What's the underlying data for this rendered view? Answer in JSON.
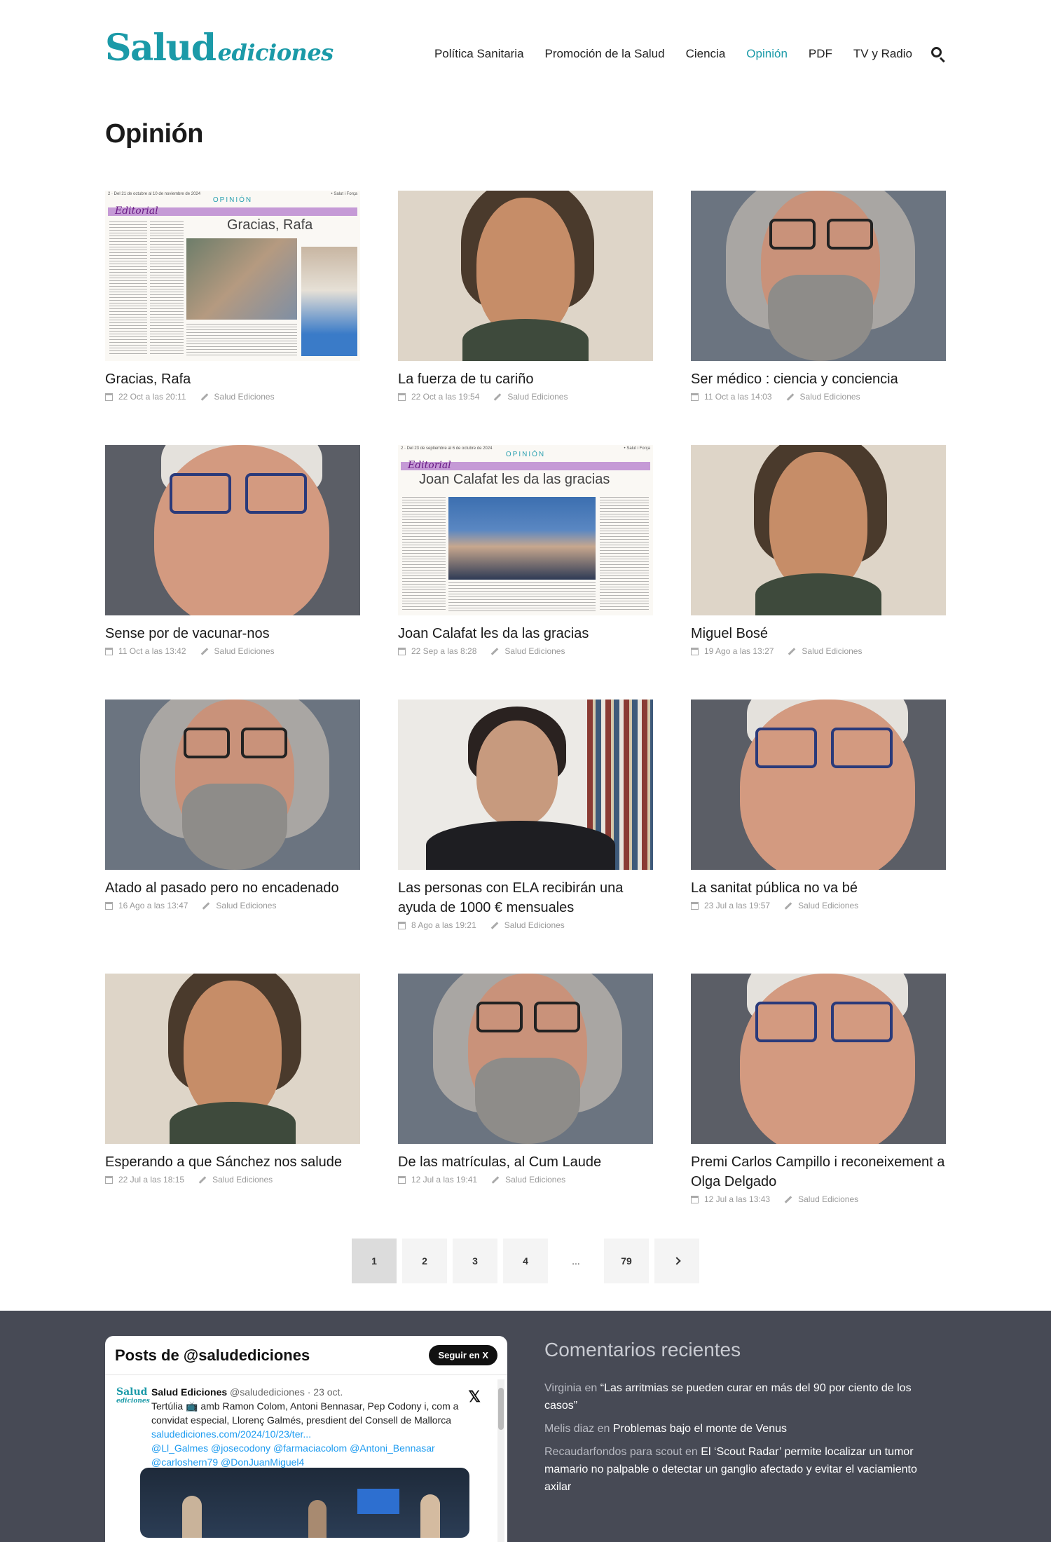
{
  "header": {
    "logo_main": "Salud",
    "logo_sub": "ediciones",
    "nav": [
      {
        "label": "Política Sanitaria",
        "active": false
      },
      {
        "label": "Promoción de la Salud",
        "active": false
      },
      {
        "label": "Ciencia",
        "active": false
      },
      {
        "label": "Opinión",
        "active": true
      },
      {
        "label": "PDF",
        "active": false
      },
      {
        "label": "TV y Radio",
        "active": false
      }
    ],
    "accent": "#1b9aa8"
  },
  "page_title": "Opinión",
  "articles": [
    {
      "title": "Gracias, Rafa",
      "date": "22 Oct a las 20:11",
      "author": "Salud Ediciones",
      "thumb": "newspaper-gracias-rafa"
    },
    {
      "title": "La fuerza de tu cariño",
      "date": "22 Oct a las 19:54",
      "author": "Salud Ediciones",
      "thumb": "portrait-long-hair-man"
    },
    {
      "title": "Ser médico : ciencia y conciencia",
      "date": "11 Oct a las 14:03",
      "author": "Salud Ediciones",
      "thumb": "portrait-grey-beard-man"
    },
    {
      "title": "Sense por de vacunar-nos",
      "date": "11 Oct a las 13:42",
      "author": "Salud Ediciones",
      "thumb": "portrait-smiling-man-glasses"
    },
    {
      "title": "Joan Calafat les da las gracias",
      "date": "22 Sep a las 8:28",
      "author": "Salud Ediciones",
      "thumb": "newspaper-joan-calafat"
    },
    {
      "title": "Miguel Bosé",
      "date": "19 Ago a las 13:27",
      "author": "Salud Ediciones",
      "thumb": "portrait-long-hair-man"
    },
    {
      "title": "Atado al pasado pero no encadenado",
      "date": "16 Ago a las 13:47",
      "author": "Salud Ediciones",
      "thumb": "portrait-grey-beard-man"
    },
    {
      "title": "Las personas con ELA recibirán una ayuda de 1000 € mensuales",
      "date": "8 Ago a las 19:21",
      "author": "Salud Ediciones",
      "thumb": "portrait-woman-bookshelf"
    },
    {
      "title": "La sanitat pública no va bé",
      "date": "23 Jul a las 19:57",
      "author": "Salud Ediciones",
      "thumb": "portrait-smiling-man-glasses"
    },
    {
      "title": "Esperando a que Sánchez nos salude",
      "date": "22 Jul a las 18:15",
      "author": "Salud Ediciones",
      "thumb": "portrait-long-hair-man"
    },
    {
      "title": "De las matrículas, al Cum Laude",
      "date": "12 Jul a las 19:41",
      "author": "Salud Ediciones",
      "thumb": "portrait-grey-beard-man"
    },
    {
      "title": "Premi Carlos Campillo i reconeixement a Olga Delgado",
      "date": "12 Jul a las 13:43",
      "author": "Salud Ediciones",
      "thumb": "portrait-smiling-man-glasses"
    }
  ],
  "newspaper": {
    "gracias": {
      "top_left": "2 · Del 21 de octubre al 10 de noviembre de 2024",
      "top_right": "• Salut i Força",
      "section": "OPINIÓN",
      "tag": "Editorial",
      "headline": "Gracias, Rafa"
    },
    "calafat": {
      "top_left": "2 · Del 23 de septiembre al 6 de octubre de 2024",
      "top_right": "• Salut i Força",
      "section": "OPINIÓN",
      "tag": "Editorial",
      "headline": "Joan Calafat les da las gracias"
    }
  },
  "pagination": {
    "pages": [
      "1",
      "2",
      "3",
      "4"
    ],
    "ellipsis": "...",
    "last": "79",
    "current": "1"
  },
  "footer": {
    "x_widget": {
      "title": "Posts de @saludediciones",
      "follow_label": "Seguir en X",
      "tweet": {
        "avatar_main": "Salud",
        "avatar_sub": "ediciones",
        "name": "Salud Ediciones",
        "handle": "@saludediciones · 23 oct.",
        "text": "Tertúlia 📺 amb Ramon Colom, Antoni Bennasar, Pep Codony i, com a convidat especial, Llorenç Galmés, presdient del Consell de Mallorca",
        "link": "saludediciones.com/2024/10/23/ter...",
        "mentions": "@Ll_Galmes @josecodony @farmaciacolom  @Antoni_Bennasar @carloshern79 @DonJuanMiguel4"
      }
    },
    "comments": {
      "title": "Comentarios recientes",
      "connector": "en",
      "items": [
        {
          "author": "Virginia",
          "text": "“Las arritmias se pueden curar en más del 90 por ciento de los casos”"
        },
        {
          "author": "Melis diaz",
          "text": "Problemas bajo el monte de Venus"
        },
        {
          "author": "Recaudarfondos para scout",
          "text": "El ‘Scout Radar’ permite localizar un tumor mamario no palpable o detectar un ganglio afectado y evitar el vaciamiento axilar"
        }
      ]
    }
  }
}
